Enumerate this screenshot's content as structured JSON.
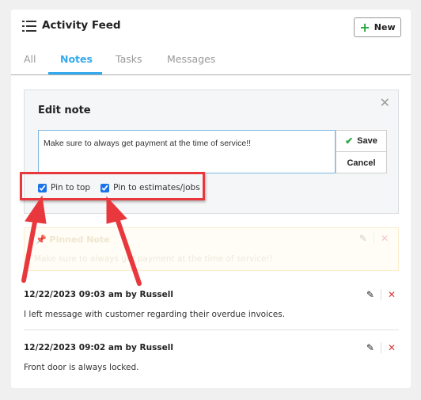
{
  "header": {
    "title": "Activity Feed",
    "new_button_label": "New"
  },
  "tabs": [
    {
      "label": "All",
      "active": false
    },
    {
      "label": "Notes",
      "active": true
    },
    {
      "label": "Tasks",
      "active": false
    },
    {
      "label": "Messages",
      "active": false
    }
  ],
  "edit_note": {
    "title": "Edit note",
    "note_value": "Make sure to always get payment at the time of service!!",
    "save_label": "Save",
    "cancel_label": "Cancel",
    "checkboxes": [
      {
        "label": "Pin to top",
        "checked": true
      },
      {
        "label": "Pin to estimates/jobs",
        "checked": true
      }
    ]
  },
  "pinned_note": {
    "title": "Pinned Note",
    "text": "Make sure to always get payment at the time of service!!"
  },
  "entries": [
    {
      "header": "12/22/2023 09:03 am by Russell",
      "text": "I left message with customer regarding their overdue invoices."
    },
    {
      "header": "12/22/2023 09:02 am by Russell",
      "text": "Front door is always locked."
    }
  ],
  "colors": {
    "accent": "#33aaee",
    "annotation_red": "#e8383d",
    "delete_red": "#d9383a",
    "success_green": "#28a745"
  }
}
